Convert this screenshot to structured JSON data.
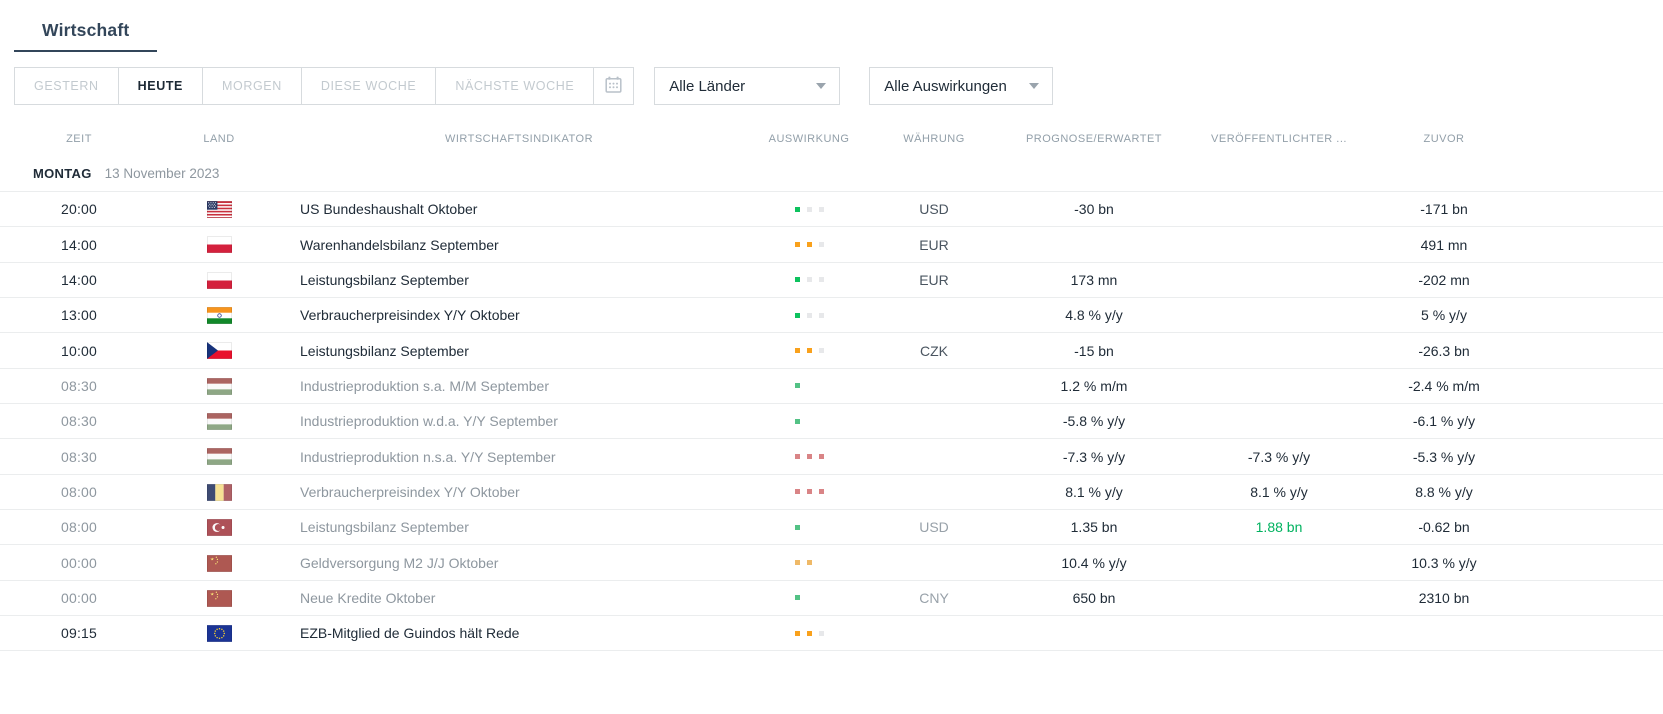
{
  "colors": {
    "accent_dark": "#33465a",
    "impact_green": "#0dc25e",
    "impact_orange": "#f9a11c",
    "impact_red": "#f2696c",
    "impact_gray": "#e7e8ea",
    "actual_positive_green": "#00b25f"
  },
  "tabs": {
    "active": "Wirtschaft"
  },
  "filters": {
    "ranges": [
      {
        "label": "GESTERN",
        "active": false
      },
      {
        "label": "HEUTE",
        "active": true
      },
      {
        "label": "MORGEN",
        "active": false
      },
      {
        "label": "DIESE WOCHE",
        "active": false
      },
      {
        "label": "NÄCHSTE WOCHE",
        "active": false
      }
    ],
    "calendar_icon": "calendar-icon",
    "country_filter": {
      "value": "Alle Länder",
      "icon": "chevron-down-icon"
    },
    "impact_filter": {
      "value": "Alle Auswirkungen",
      "icon": "chevron-down-icon"
    }
  },
  "table": {
    "columns": [
      {
        "key": "zeit",
        "label": "ZEIT"
      },
      {
        "key": "land",
        "label": "LAND"
      },
      {
        "key": "wirtschaftsindikator",
        "label": "WIRTSCHAFTSINDIKATOR"
      },
      {
        "key": "auswirkung",
        "label": "AUSWIRKUNG"
      },
      {
        "key": "waehrung",
        "label": "WÄHRUNG"
      },
      {
        "key": "prognose-erwartet",
        "label": "PROGNOSE/ERWARTET"
      },
      {
        "key": "veroeffentlichter",
        "label": "VERÖFFENTLICHTER ..."
      },
      {
        "key": "zuvor",
        "label": "ZUVOR"
      }
    ],
    "group": {
      "day": "MONTAG",
      "date": "13 November 2023"
    },
    "rows": [
      {
        "time": "20:00",
        "country": "us",
        "indicator": "US Bundeshaushalt Oktober",
        "impact": [
          "green",
          "gray",
          "gray"
        ],
        "currency": "USD",
        "forecast": "-30 bn",
        "actual": "",
        "actual_positive": false,
        "previous": "-171 bn",
        "muted": false
      },
      {
        "time": "14:00",
        "country": "pl",
        "indicator": "Warenhandelsbilanz September",
        "impact": [
          "orange",
          "orange",
          "gray"
        ],
        "currency": "EUR",
        "forecast": "",
        "actual": "",
        "actual_positive": false,
        "previous": "491 mn",
        "muted": false
      },
      {
        "time": "14:00",
        "country": "pl",
        "indicator": "Leistungsbilanz September",
        "impact": [
          "green",
          "gray",
          "gray"
        ],
        "currency": "EUR",
        "forecast": "173 mn",
        "actual": "",
        "actual_positive": false,
        "previous": "-202 mn",
        "muted": false
      },
      {
        "time": "13:00",
        "country": "in",
        "indicator": "Verbraucherpreisindex Y/Y Oktober",
        "impact": [
          "green",
          "gray",
          "gray"
        ],
        "currency": "",
        "forecast": "4.8 % y/y",
        "actual": "",
        "actual_positive": false,
        "previous": "5 % y/y",
        "muted": false
      },
      {
        "time": "10:00",
        "country": "cz",
        "indicator": "Leistungsbilanz September",
        "impact": [
          "orange",
          "orange",
          "gray"
        ],
        "currency": "CZK",
        "forecast": "-15 bn",
        "actual": "",
        "actual_positive": false,
        "previous": "-26.3 bn",
        "muted": false
      },
      {
        "time": "08:30",
        "country": "hu",
        "indicator": "Industrieproduktion s.a. M/M September",
        "impact": [
          "green",
          "gray",
          "gray"
        ],
        "currency": "",
        "forecast": "1.2 % m/m",
        "actual": "",
        "actual_positive": false,
        "previous": "-2.4 % m/m",
        "muted": true
      },
      {
        "time": "08:30",
        "country": "hu",
        "indicator": "Industrieproduktion w.d.a. Y/Y September",
        "impact": [
          "green",
          "gray",
          "gray"
        ],
        "currency": "",
        "forecast": "-5.8 % y/y",
        "actual": "",
        "actual_positive": false,
        "previous": "-6.1 % y/y",
        "muted": true
      },
      {
        "time": "08:30",
        "country": "hu",
        "indicator": "Industrieproduktion n.s.a. Y/Y September",
        "impact": [
          "red",
          "red",
          "red"
        ],
        "currency": "",
        "forecast": "-7.3 % y/y",
        "actual": "-7.3 % y/y",
        "actual_positive": false,
        "previous": "-5.3 % y/y",
        "muted": true
      },
      {
        "time": "08:00",
        "country": "ro",
        "indicator": "Verbraucherpreisindex Y/Y Oktober",
        "impact": [
          "red",
          "red",
          "red"
        ],
        "currency": "",
        "forecast": "8.1 % y/y",
        "actual": "8.1 % y/y",
        "actual_positive": false,
        "previous": "8.8 % y/y",
        "muted": true
      },
      {
        "time": "08:00",
        "country": "tr",
        "indicator": "Leistungsbilanz September",
        "impact": [
          "green",
          "gray",
          "gray"
        ],
        "currency": "USD",
        "forecast": "1.35 bn",
        "actual": "1.88 bn",
        "actual_positive": true,
        "previous": "-0.62 bn",
        "muted": true
      },
      {
        "time": "00:00",
        "country": "cn",
        "indicator": "Geldversorgung M2 J/J Oktober",
        "impact": [
          "orange",
          "orange",
          "gray"
        ],
        "currency": "",
        "forecast": "10.4 % y/y",
        "actual": "",
        "actual_positive": false,
        "previous": "10.3 % y/y",
        "muted": true
      },
      {
        "time": "00:00",
        "country": "cn",
        "indicator": "Neue Kredite Oktober",
        "impact": [
          "green",
          "gray",
          "gray"
        ],
        "currency": "CNY",
        "forecast": "650 bn",
        "actual": "",
        "actual_positive": false,
        "previous": "2310 bn",
        "muted": true
      },
      {
        "time": "09:15",
        "country": "eu",
        "indicator": "EZB-Mitglied de Guindos hält Rede",
        "impact": [
          "orange",
          "orange",
          "gray"
        ],
        "currency": "",
        "forecast": "",
        "actual": "",
        "actual_positive": false,
        "previous": "",
        "muted": false
      }
    ]
  }
}
